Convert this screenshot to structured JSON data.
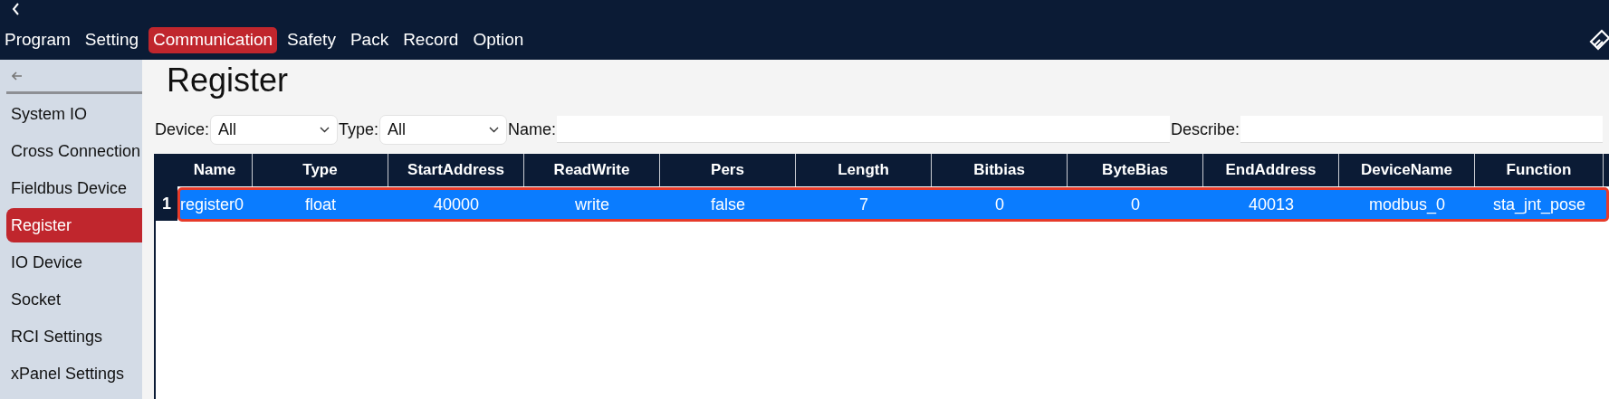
{
  "top_bar": {
    "menu": [
      {
        "label": "Program",
        "selected": false
      },
      {
        "label": "Setting",
        "selected": false
      },
      {
        "label": "Communication",
        "selected": true
      },
      {
        "label": "Safety",
        "selected": false
      },
      {
        "label": "Pack",
        "selected": false
      },
      {
        "label": "Record",
        "selected": false
      },
      {
        "label": "Option",
        "selected": false
      }
    ]
  },
  "sidebar": {
    "items": [
      {
        "label": "System IO",
        "selected": false
      },
      {
        "label": "Cross Connection",
        "selected": false
      },
      {
        "label": "Fieldbus Device",
        "selected": false
      },
      {
        "label": "Register",
        "selected": true
      },
      {
        "label": "IO Device",
        "selected": false
      },
      {
        "label": "Socket",
        "selected": false
      },
      {
        "label": "RCI Settings",
        "selected": false
      },
      {
        "label": "xPanel Settings",
        "selected": false
      }
    ]
  },
  "page": {
    "title": "Register"
  },
  "filters": [
    {
      "kind": "select",
      "label": "Device:",
      "value": "All"
    },
    {
      "kind": "select",
      "label": "Type:",
      "value": "All"
    },
    {
      "kind": "text",
      "label": "Name:"
    },
    {
      "kind": "text",
      "label": "Describe:"
    }
  ],
  "table": {
    "columns": [
      "Name",
      "Type",
      "StartAddress",
      "ReadWrite",
      "Pers",
      "Length",
      "Bitbias",
      "ByteBias",
      "EndAddress",
      "DeviceName",
      "Function"
    ],
    "rows": [
      {
        "number": "1",
        "selected": true,
        "cells": [
          "register0",
          "float",
          "40000",
          "write",
          "false",
          "7",
          "0",
          "0",
          "40013",
          "modbus_0",
          "sta_jnt_pose"
        ]
      }
    ]
  }
}
